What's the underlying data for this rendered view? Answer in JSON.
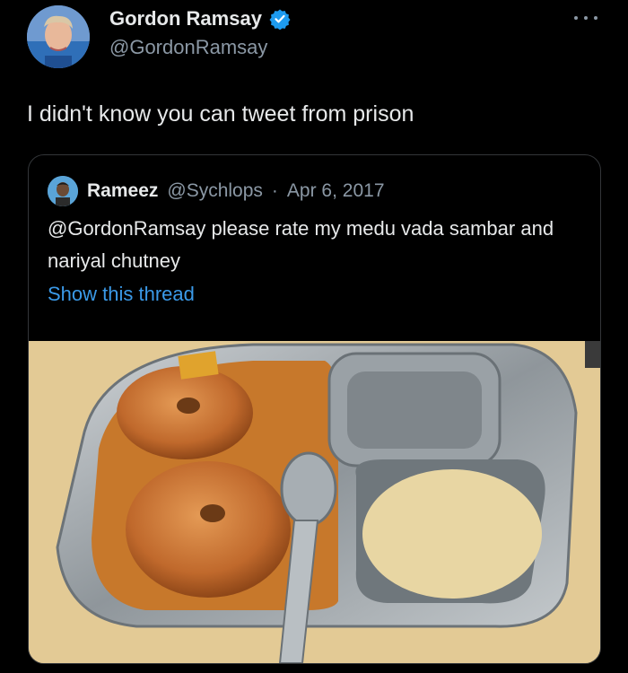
{
  "tweet": {
    "author": {
      "display_name": "Gordon Ramsay",
      "handle": "@GordonRamsay",
      "verified": true
    },
    "text": "I didn't know you can tweet from prison",
    "more_icon": "more-dots-icon"
  },
  "quoted_tweet": {
    "author": {
      "display_name": "Rameez",
      "handle": "@Sychlops"
    },
    "separator": "·",
    "date": "Apr 6, 2017",
    "text": "@GordonRamsay please rate my medu vada sambar and nariyal chutney",
    "show_thread_label": "Show this thread",
    "photo_subject": "medu vada with sambar and coconut chutney on steel plate"
  },
  "colors": {
    "background": "#000000",
    "text_primary": "#e7e9ea",
    "text_secondary": "#8b98a5",
    "link": "#3b9ae8",
    "verified": "#1d9bf0",
    "border": "#333639"
  }
}
